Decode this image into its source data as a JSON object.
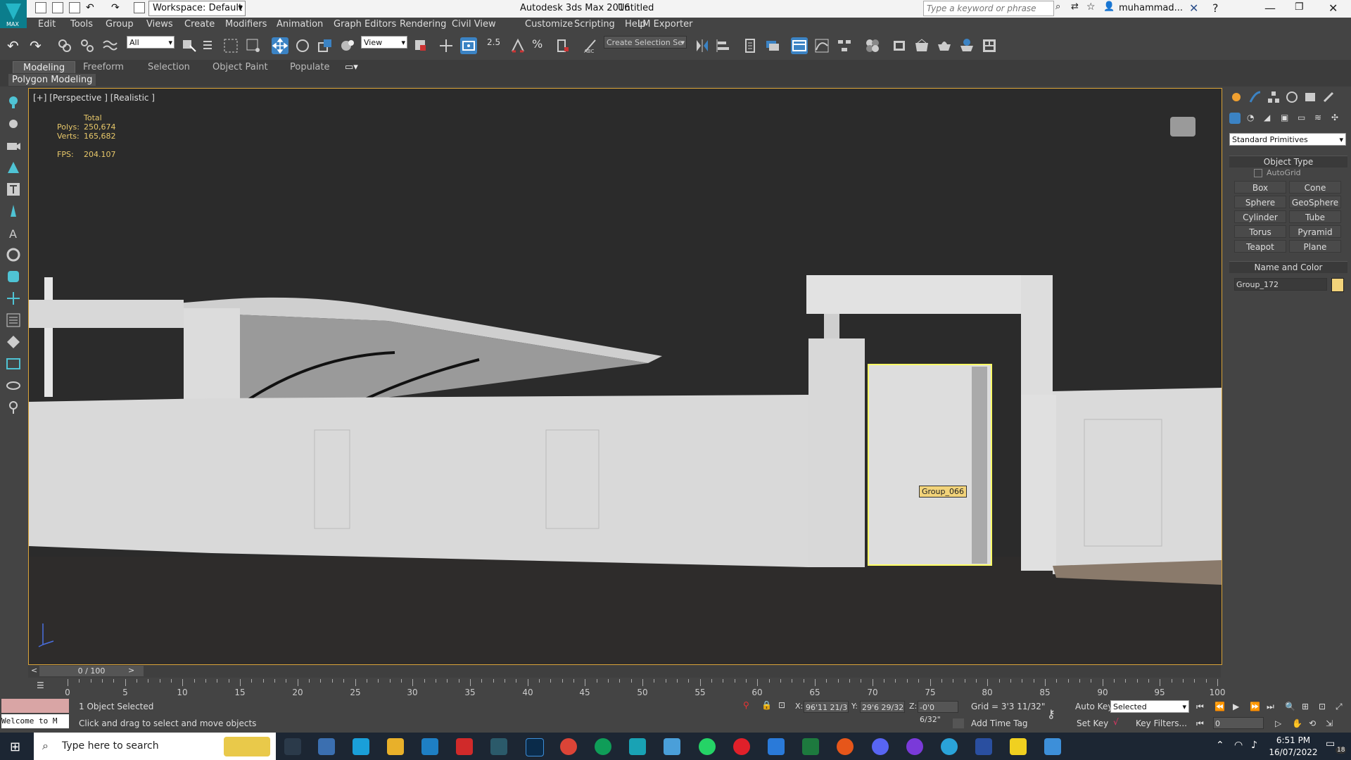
{
  "titlebar": {
    "workspace": "Workspace: Default",
    "app_title": "Autodesk 3ds Max 2016",
    "doc_title": "Untitled",
    "search_placeholder": "Type a keyword or phrase",
    "user": "muhammad..."
  },
  "menu": [
    "Edit",
    "Tools",
    "Group",
    "Views",
    "Create",
    "Modifiers",
    "Animation",
    "Graph Editors",
    "Rendering",
    "Civil View",
    "Customize",
    "Scripting",
    "Help",
    "LM Exporter"
  ],
  "toolbar": {
    "filter": "All",
    "ref_coord": "View",
    "selection_set": "Create Selection Se",
    "snap_angle": "2.5"
  },
  "ribbon": {
    "tabs": [
      "Modeling",
      "Freeform",
      "Selection",
      "Object Paint",
      "Populate"
    ],
    "active_tab": "Modeling",
    "panel": "Polygon Modeling"
  },
  "viewport": {
    "label": "[+] [Perspective ] [Realistic ]",
    "stats": {
      "total_label": "Total",
      "polys_label": "Polys:",
      "polys": "250,674",
      "verts_label": "Verts:",
      "verts": "165,682",
      "fps_label": "FPS:",
      "fps": "204.107"
    },
    "tooltip": "Group_066"
  },
  "command_panel": {
    "category": "Standard Primitives",
    "object_type_title": "Object Type",
    "autogrid": "AutoGrid",
    "buttons": [
      "Box",
      "Cone",
      "Sphere",
      "GeoSphere",
      "Cylinder",
      "Tube",
      "Torus",
      "Pyramid",
      "Teapot",
      "Plane"
    ],
    "name_color_title": "Name and Color",
    "object_name": "Group_172",
    "object_color": "#f2d37a"
  },
  "timeline": {
    "frame": "0 / 100",
    "ticks": [
      "0",
      "5",
      "10",
      "15",
      "20",
      "25",
      "30",
      "35",
      "40",
      "45",
      "50",
      "55",
      "60",
      "65",
      "70",
      "75",
      "80",
      "85",
      "90",
      "95",
      "100"
    ]
  },
  "status": {
    "maxscript": "Welcome to M",
    "selected": "1 Object Selected",
    "prompt": "Click and drag to select and move objects",
    "x_label": "X:",
    "x": "96'11 21/3",
    "y_label": "Y:",
    "y": "29'6 29/32",
    "z_label": "Z:",
    "z": "-0'0 6/32\"",
    "grid": "Grid = 3'3 11/32\"",
    "add_time_tag": "Add Time Tag",
    "auto_key": "Auto Key",
    "set_key": "Set Key",
    "key_mode": "Selected",
    "key_filters": "Key Filters...",
    "frame_field": "0"
  },
  "taskbar": {
    "search": "Type here to search",
    "time": "6:51 PM",
    "date": "16/07/2022",
    "notif": "18"
  },
  "colors": {
    "accent": "#d9a338",
    "selection": "#ffff66",
    "viewport_bg": "#2b2b2b"
  }
}
